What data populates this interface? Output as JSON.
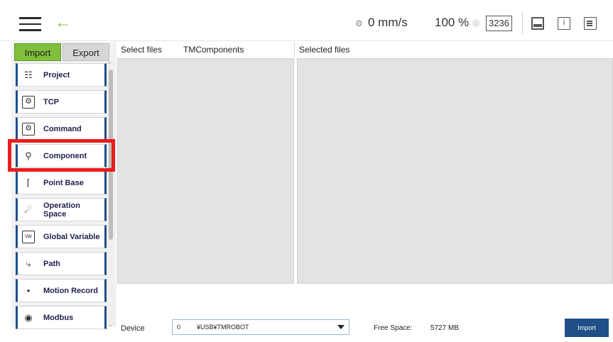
{
  "header": {
    "speed": "0 mm/s",
    "percent": "100 %",
    "counter": "3236",
    "icons": [
      "menu-icon",
      "back-arrow-icon",
      "robot-speed-icon",
      "visual-icon",
      "display-icon",
      "info-icon",
      "log-icon"
    ]
  },
  "tabs": {
    "import": "Import",
    "export": "Export"
  },
  "sidebar": {
    "items": [
      {
        "label": "Project",
        "icon": "project-icon"
      },
      {
        "label": "TCP",
        "icon": "tcp-icon"
      },
      {
        "label": "Command",
        "icon": "command-icon"
      },
      {
        "label": "Component",
        "icon": "component-icon"
      },
      {
        "label": "Point Base",
        "icon": "point-base-icon"
      },
      {
        "label": "Operation Space",
        "label_line1": "Operation",
        "label_line2": "Space",
        "icon": "operation-space-icon"
      },
      {
        "label": "Global Variable",
        "icon": "global-variable-icon"
      },
      {
        "label": "Path",
        "icon": "path-icon"
      },
      {
        "label": "Motion Record",
        "icon": "motion-record-icon"
      },
      {
        "label": "Modbus",
        "icon": "modbus-icon"
      }
    ]
  },
  "columns": {
    "select_files": "Select files",
    "tm_components": "TMComponents",
    "selected_files": "Selected files"
  },
  "footer": {
    "device_label": "Device",
    "device_number": "0",
    "device_path": "¥USB¥TMROBOT",
    "free_space_label": "Free Space:",
    "free_space_value": "5727 MB",
    "import_button": "Import"
  },
  "colors": {
    "accent_green": "#7fbf3a",
    "nav_blue": "#1f4f86",
    "highlight_red": "#ee1c1c"
  }
}
